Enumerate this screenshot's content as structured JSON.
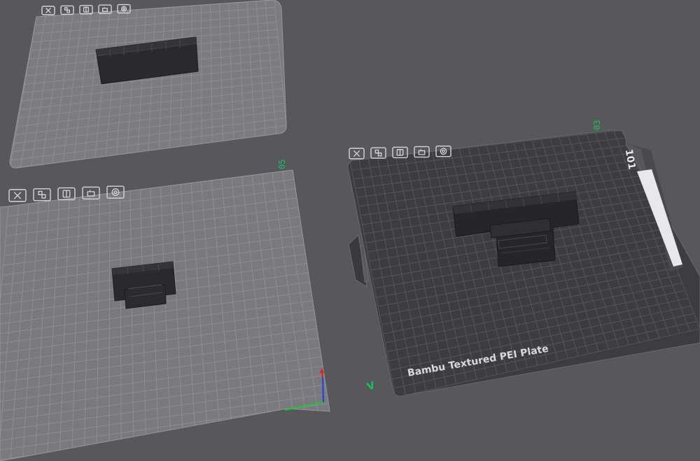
{
  "viewport": {
    "background": "#58585c",
    "plate_light_fill": "#7c7c80",
    "plate_dark_fill": "#3d3d40",
    "grid_light": "#9a9a9e",
    "grid_dark": "#56565a",
    "accent_green": "#19c35a"
  },
  "plates": [
    {
      "id": "plate-top-left",
      "number": "",
      "style": "light",
      "toolbar_icons": [
        "delete-icon",
        "arrange-icon",
        "orient-icon",
        "lock-icon",
        "settings-icon"
      ]
    },
    {
      "id": "plate-bottom-left",
      "number": "05",
      "style": "light",
      "toolbar_icons": [
        "delete-icon",
        "arrange-icon",
        "orient-icon",
        "lock-icon",
        "settings-icon"
      ]
    },
    {
      "id": "plate-right",
      "number": "03",
      "style": "dark",
      "plate_name": "Bambu Textured PEI Plate",
      "corner_label": "V",
      "logo_text": "101",
      "toolbar_icons": [
        "delete-icon",
        "arrange-icon",
        "orient-icon",
        "lock-icon",
        "settings-icon"
      ]
    }
  ],
  "axes": {
    "x_color": "#1ec832",
    "y_color": "#2040e0",
    "z_color": "#e02020"
  }
}
